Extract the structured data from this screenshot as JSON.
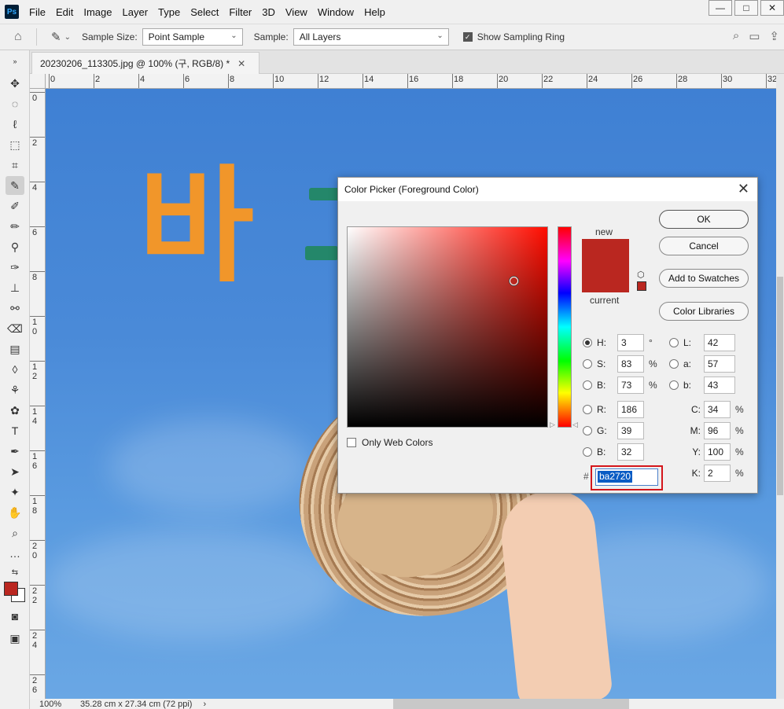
{
  "menubar": {
    "logo": "Ps",
    "items": [
      "File",
      "Edit",
      "Image",
      "Layer",
      "Type",
      "Select",
      "Filter",
      "3D",
      "View",
      "Window",
      "Help"
    ],
    "window_buttons": [
      "—",
      "□",
      "✕"
    ]
  },
  "options": {
    "sample_size_label": "Sample Size:",
    "sample_size_value": "Point Sample",
    "sample_label": "Sample:",
    "sample_value": "All Layers",
    "show_ring_label": "Show Sampling Ring",
    "show_ring_checked": true
  },
  "document": {
    "tab_title": "20230206_113305.jpg @ 100% (구, RGB/8) *",
    "canvas_text": "바"
  },
  "rulers": {
    "top": [
      "0",
      "2",
      "4",
      "6",
      "8",
      "10",
      "12",
      "14",
      "16",
      "18",
      "20",
      "22",
      "24",
      "26",
      "28",
      "30",
      "32"
    ],
    "left": [
      "0",
      "2",
      "4",
      "6",
      "8",
      "10",
      "12",
      "14",
      "16",
      "18",
      "20",
      "22",
      "24",
      "26"
    ]
  },
  "status": {
    "zoom": "100%",
    "doc_info": "35.28 cm x 27.34 cm (72 ppi)",
    "arrow": "›"
  },
  "picker": {
    "title": "Color Picker (Foreground Color)",
    "new_label": "new",
    "current_label": "current",
    "new_color": "#ba2720",
    "current_color": "#ba2720",
    "buttons": {
      "ok": "OK",
      "cancel": "Cancel",
      "add_swatches": "Add to Swatches",
      "color_libraries": "Color Libraries"
    },
    "hsb": [
      {
        "label": "H:",
        "value": "3",
        "unit": "°",
        "selected": true
      },
      {
        "label": "S:",
        "value": "83",
        "unit": "%",
        "selected": false
      },
      {
        "label": "B:",
        "value": "73",
        "unit": "%",
        "selected": false
      }
    ],
    "rgb": [
      {
        "label": "R:",
        "value": "186"
      },
      {
        "label": "G:",
        "value": "39"
      },
      {
        "label": "B:",
        "value": "32"
      }
    ],
    "lab": [
      {
        "label": "L:",
        "value": "42"
      },
      {
        "label": "a:",
        "value": "57"
      },
      {
        "label": "b:",
        "value": "43"
      }
    ],
    "cmyk": [
      {
        "label": "C:",
        "value": "34",
        "unit": "%"
      },
      {
        "label": "M:",
        "value": "96",
        "unit": "%"
      },
      {
        "label": "Y:",
        "value": "100",
        "unit": "%"
      },
      {
        "label": "K:",
        "value": "2",
        "unit": "%"
      }
    ],
    "hex_hash": "#",
    "hex_value": "ba2720",
    "only_web_colors_label": "Only Web Colors",
    "only_web_colors_checked": false
  },
  "colors": {
    "accent_red": "#ba2720",
    "highlight_box": "#d4161b"
  }
}
